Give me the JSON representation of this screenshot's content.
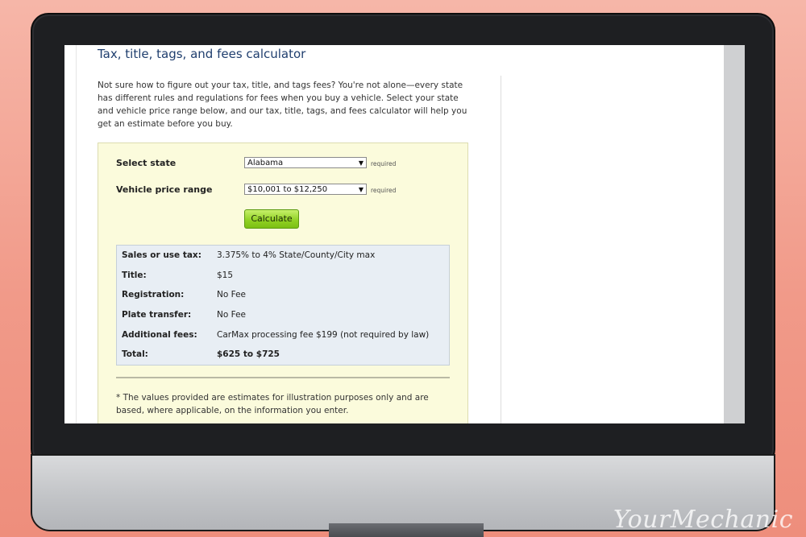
{
  "page": {
    "title": "Tax, title, tags, and fees calculator",
    "intro": "Not sure how to figure out your tax, title, and tags fees? You're not alone—every state has different rules and regulations for fees when you buy a vehicle. Select your state and vehicle price range below, and our tax, title, tags, and fees calculator will help you get an estimate before you buy."
  },
  "form": {
    "state_label": "Select state",
    "state_value": "Alabama",
    "price_label": "Vehicle price range",
    "price_value": "$10,001 to $12,250",
    "required_text": "required",
    "calculate_label": "Calculate"
  },
  "results": [
    {
      "label": "Sales or use tax:",
      "value": "3.375% to 4% State/County/City max"
    },
    {
      "label": "Title:",
      "value": "$15"
    },
    {
      "label": "Registration:",
      "value": "No Fee"
    },
    {
      "label": "Plate transfer:",
      "value": "No Fee"
    },
    {
      "label": "Additional fees:",
      "value": "CarMax processing fee $199 (not required by law)"
    },
    {
      "label": "Total:",
      "value": "$625 to $725"
    }
  ],
  "footnote": "* The values provided are estimates for illustration purposes only and are based, where applicable, on the information you enter.",
  "logo": "YourMechanic",
  "colors": {
    "background": "#f19a89",
    "title": "#1f3e6e",
    "calculator_bg": "#fbfbdc",
    "results_bg": "#e8eef4",
    "button": "#8fd022"
  }
}
